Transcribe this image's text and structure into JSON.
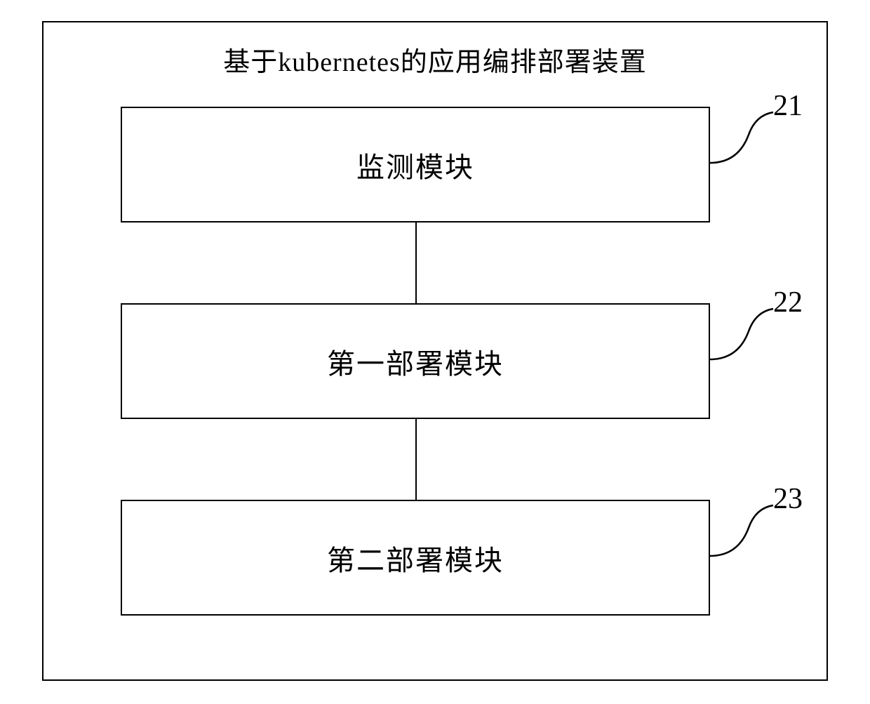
{
  "diagram": {
    "title": "基于kubernetes的应用编排部署装置",
    "modules": [
      {
        "label": "监测模块",
        "ref": "21"
      },
      {
        "label": "第一部署模块",
        "ref": "22"
      },
      {
        "label": "第二部署模块",
        "ref": "23"
      }
    ]
  }
}
